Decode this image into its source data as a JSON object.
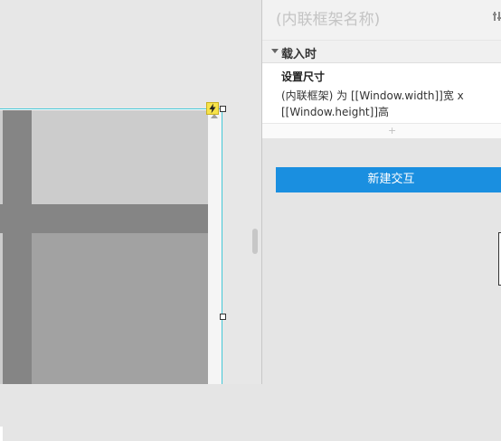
{
  "inspector": {
    "widget_name_placeholder": "(内联框架名称)",
    "event": {
      "title": "载入时",
      "case_name": "设置尺寸",
      "action_line1": "(内联框架) 为 [[Window.width]]宽 x",
      "action_line2": "[[Window.height]]高",
      "add_symbol": "+"
    },
    "new_interaction_label": "新建交互"
  },
  "icons": {
    "interaction_badge": "lightning-icon",
    "event_toggle": "caret-down-icon",
    "scroll_up": "arrow-up-icon",
    "header_settings": "settings-icon"
  },
  "colors": {
    "accent": "#1a8fe0",
    "selection": "#45c8d8",
    "badge": "#f7e34a"
  }
}
